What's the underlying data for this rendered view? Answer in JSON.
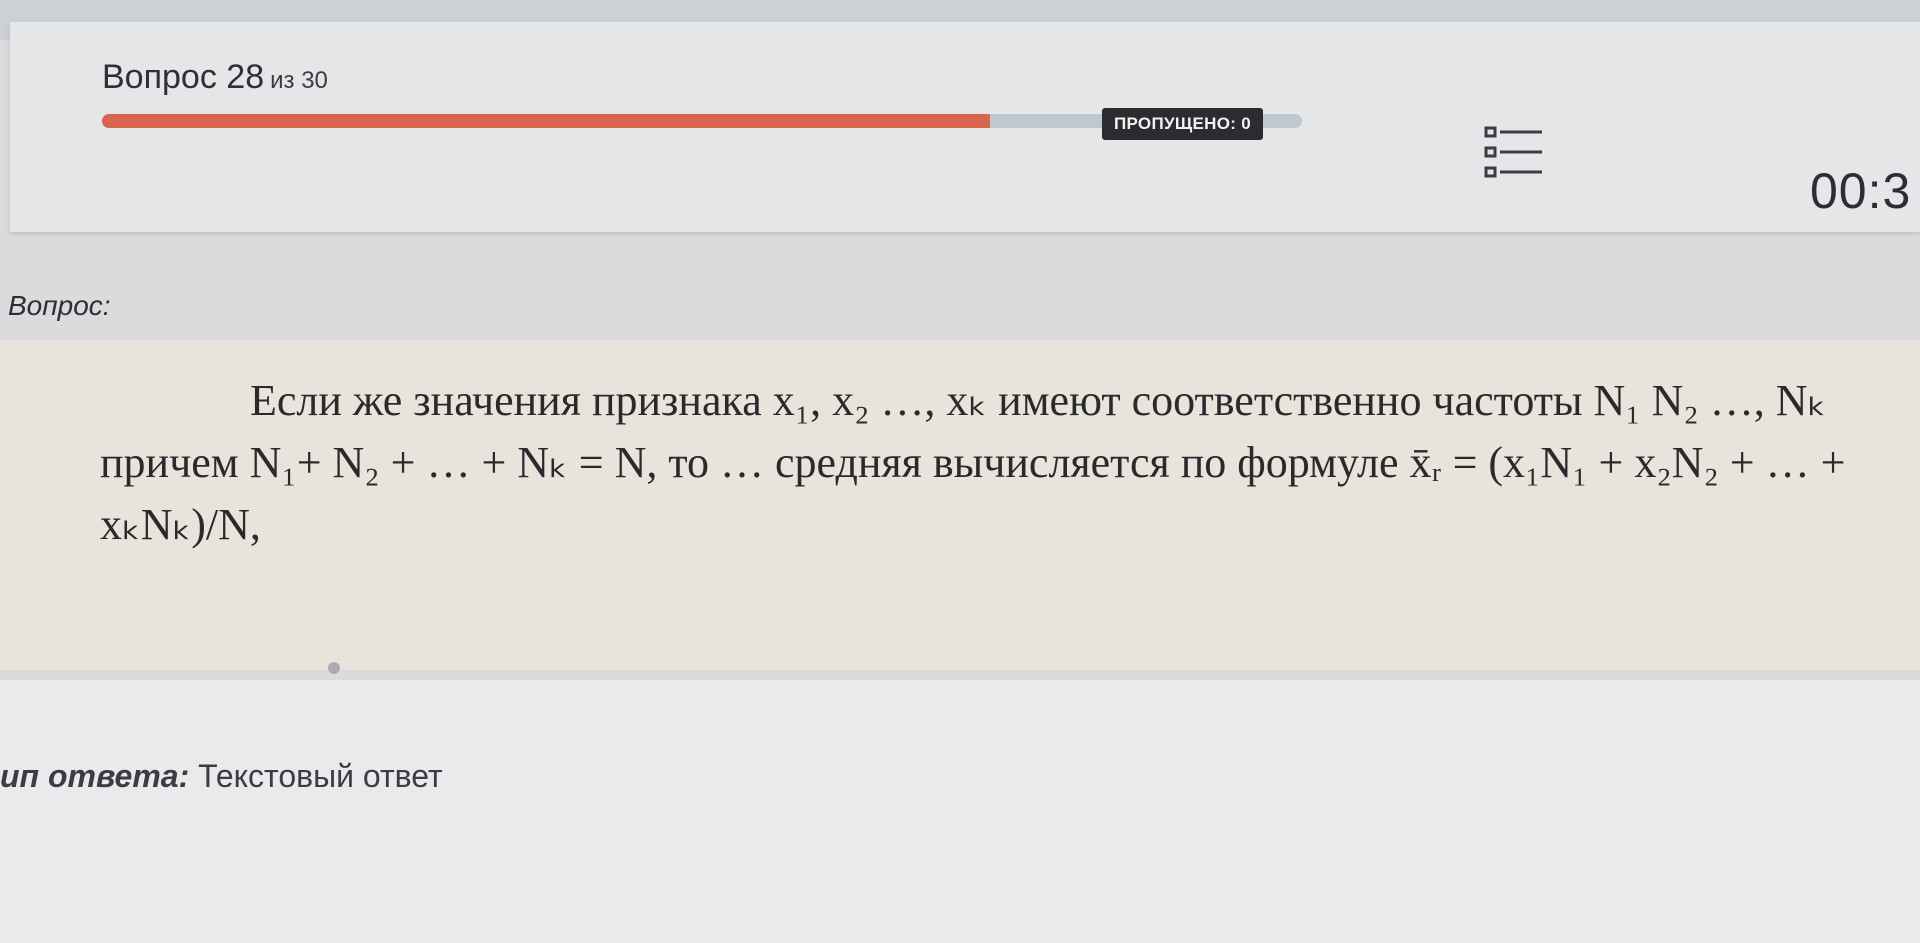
{
  "header": {
    "question_word": "Вопрос",
    "question_number": "28",
    "of_total": "из 30",
    "progress_fraction": 0.74,
    "skipped_label": "ПРОПУЩЕНО: 0",
    "timer": "00:3",
    "list_icon": "question-list-icon"
  },
  "question": {
    "label": "Вопрос:",
    "text": "Если же значения признака x₁, x₂ …, xₖ имеют соответственно частоты N₁ N₂ …, Nₖ причем N₁+ N₂ + … + Nₖ = N, то … средняя вычисляется по формуле x̄ᵣ = (x₁N₁ + x₂N₂ + … + xₖNₖ)/N,"
  },
  "answer": {
    "type_label": "ип ответа:",
    "type_value": "Текстовый ответ"
  },
  "colors": {
    "progress_fill": "#d9654e",
    "badge_bg": "#2a2c30"
  }
}
